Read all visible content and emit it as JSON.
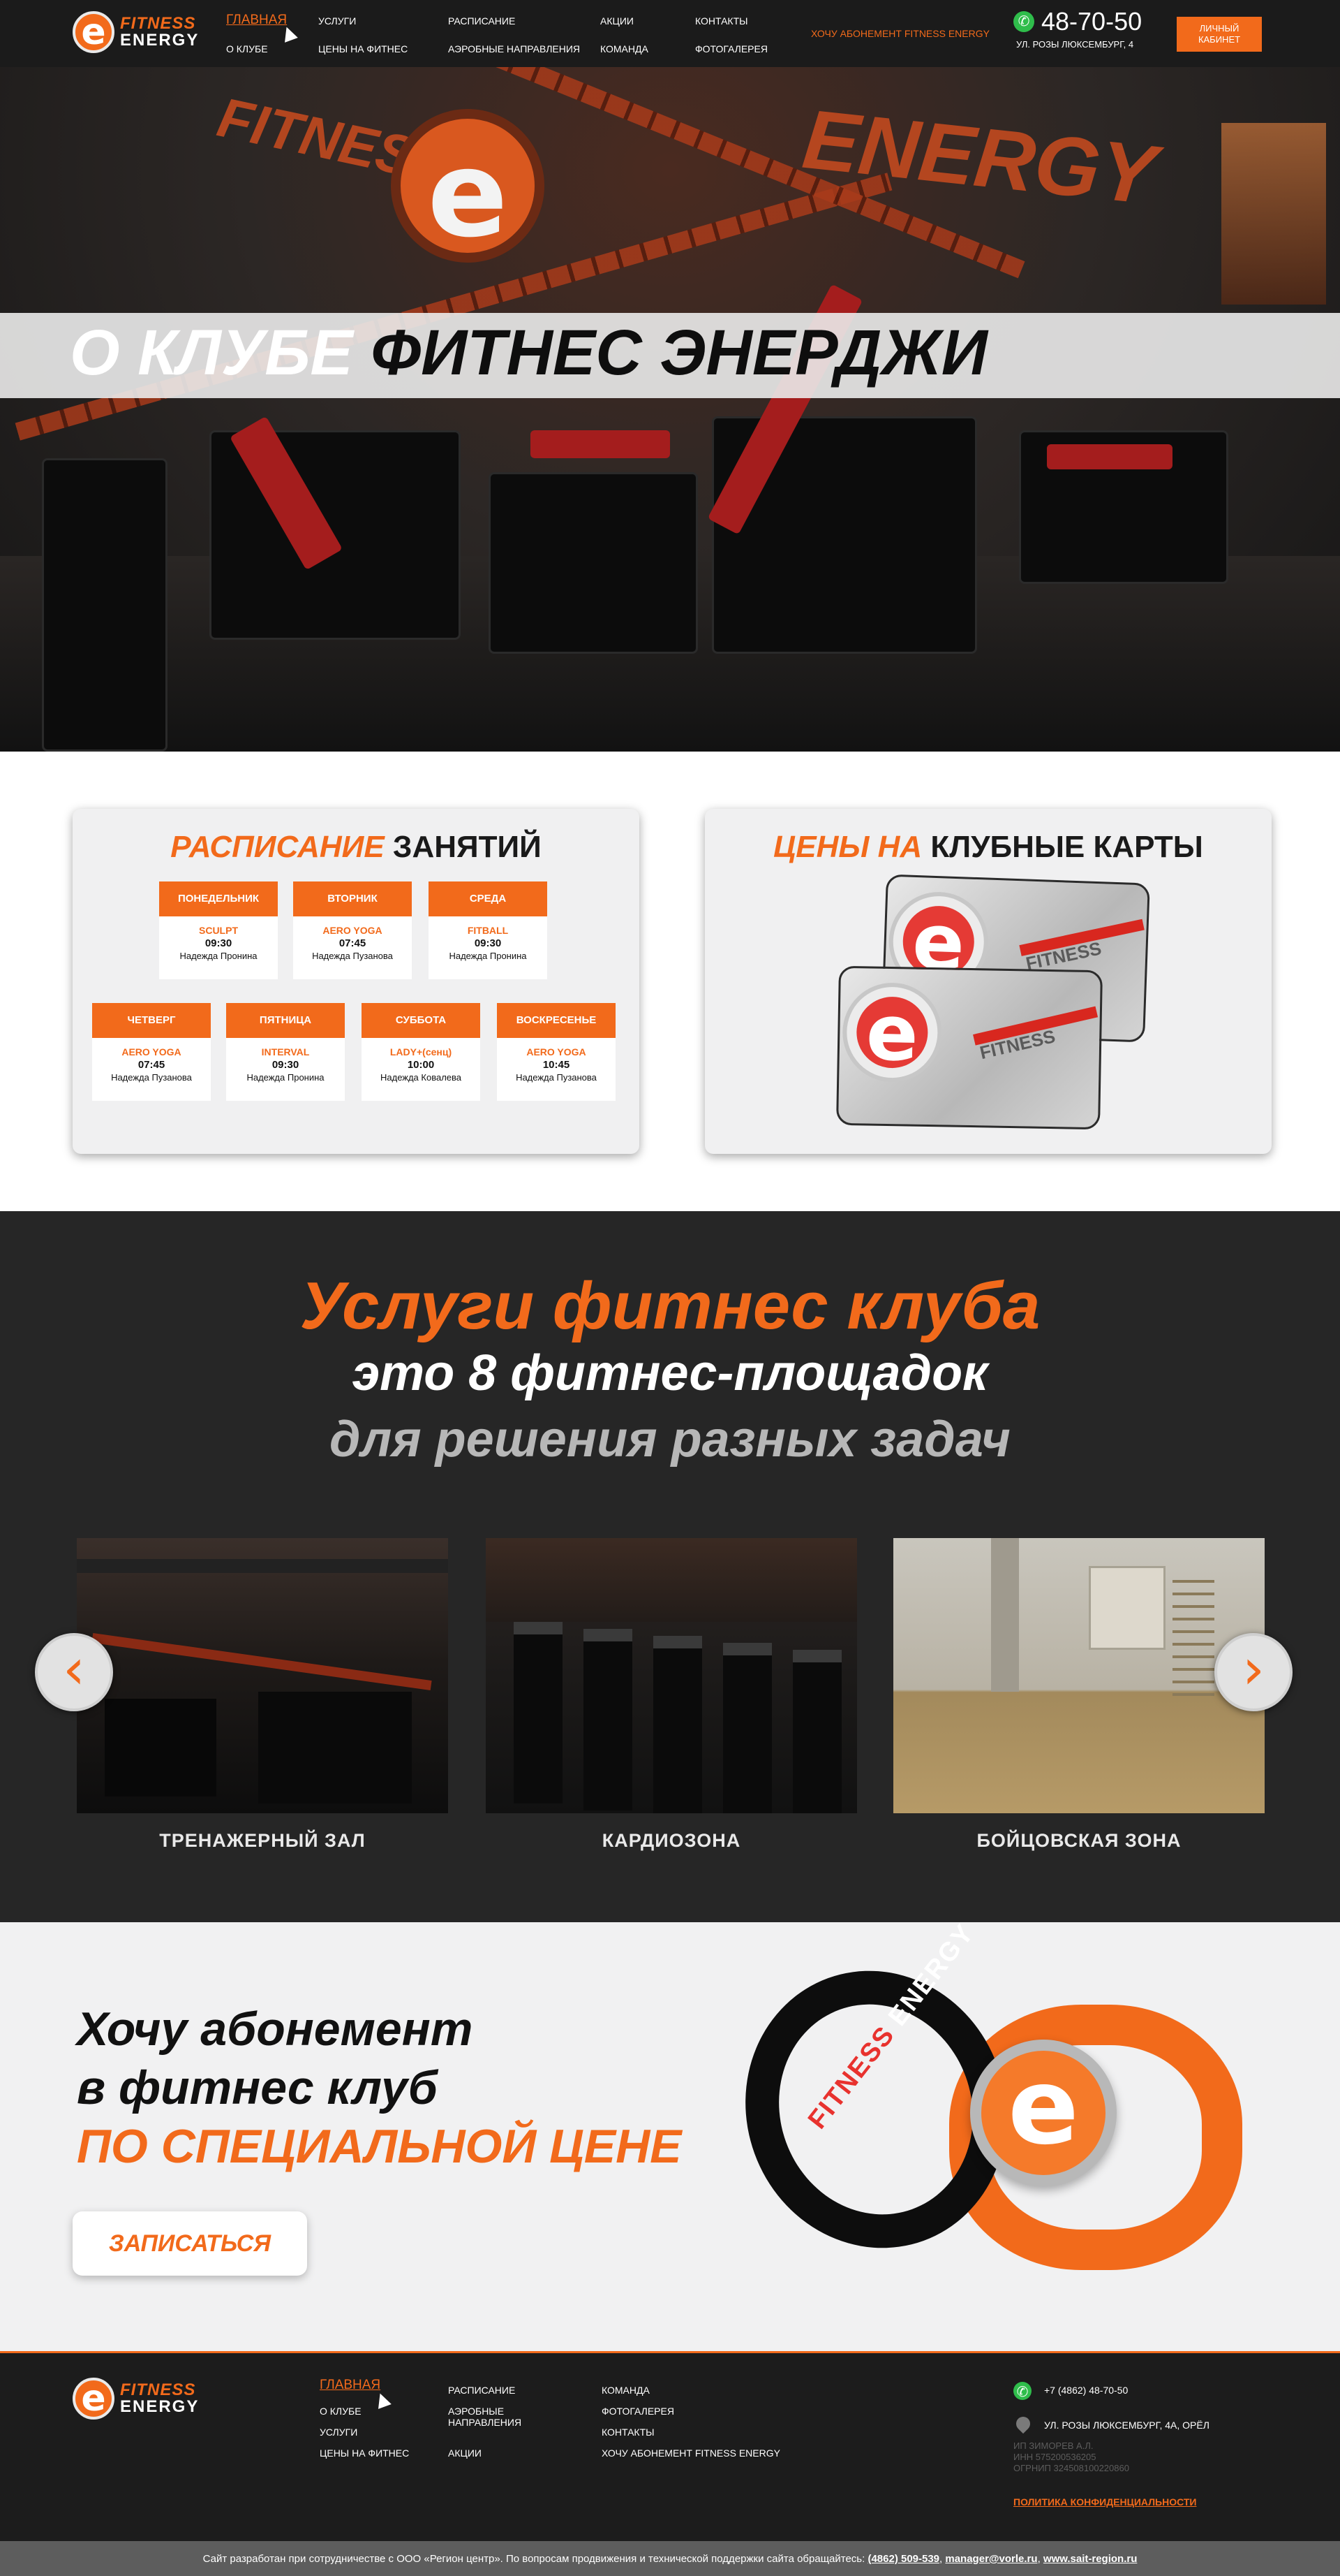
{
  "brand": {
    "word1": "FITNESS",
    "word2": "ENERGY"
  },
  "header": {
    "nav": [
      "ГЛАВНАЯ",
      "О КЛУБЕ",
      "УСЛУГИ",
      "ЦЕНЫ НА ФИТНЕС",
      "РАСПИСАНИЕ",
      "АЭРОБНЫЕ НАПРАВЛЕНИЯ",
      "АКЦИИ",
      "КОМАНДА",
      "КОНТАКТЫ",
      "ФОТОГАЛЕРЕЯ"
    ],
    "promo_link": "ХОЧУ АБОНЕМЕНТ FITNESS ENERGY",
    "phone": "48-70-50",
    "address": "УЛ. РОЗЫ ЛЮКСЕМБУРГ, 4",
    "cabinet_line1": "ЛИЧНЫЙ",
    "cabinet_line2": "КАБИНЕТ"
  },
  "hero": {
    "title_light": "О КЛУБЕ",
    "title_dark": "ФИТНЕС ЭНЕРДЖИ",
    "wall_word_left": "FITNESS",
    "wall_word_right": "ENERGY"
  },
  "schedule": {
    "title_accent": "РАСПИСАНИЕ",
    "title_rest": "ЗАНЯТИЙ",
    "days": [
      {
        "day": "ПОНЕДЕЛЬНИК",
        "class": "SCULPT",
        "time": "09:30",
        "trainer": "Надежда Пронина"
      },
      {
        "day": "ВТОРНИК",
        "class": "AERO YOGA",
        "time": "07:45",
        "trainer": "Надежда Пузанова"
      },
      {
        "day": "СРЕДА",
        "class": "FITBALL",
        "time": "09:30",
        "trainer": "Надежда Пронина"
      },
      {
        "day": "ЧЕТВЕРГ",
        "class": "AERO YOGA",
        "time": "07:45",
        "trainer": "Надежда Пузанова"
      },
      {
        "day": "ПЯТНИЦА",
        "class": "INTERVAL",
        "time": "09:30",
        "trainer": "Надежда Пронина"
      },
      {
        "day": "СУББОТА",
        "class": "LADY+(сенц)",
        "time": "10:00",
        "trainer": "Надежда Ковалева"
      },
      {
        "day": "ВОСКРЕСЕНЬЕ",
        "class": "AERO YOGA",
        "time": "10:45",
        "trainer": "Надежда Пузанова"
      }
    ]
  },
  "prices": {
    "title_accent": "ЦЕНЫ НА",
    "title_rest": "КЛУБНЫЕ КАРТЫ",
    "card_word": "FITNESS"
  },
  "services": {
    "heading1": "Услуги фитнес клуба",
    "heading2": "это 8 фитнес-площадок",
    "heading3": "для решения разных задач",
    "slides": [
      {
        "caption": "ТРЕНАЖЕРНЫЙ ЗАЛ"
      },
      {
        "caption": "КАРДИОЗОНА"
      },
      {
        "caption": "БОЙЦОВСКАЯ ЗОНА"
      }
    ],
    "prev": "‹",
    "next": "›"
  },
  "promo": {
    "line1": "Хочу абонемент",
    "line2": "в фитнес клуб",
    "line3": "ПО СПЕЦИАЛЬНОЙ ЦЕНЕ",
    "button": "ЗАПИСАТЬСЯ",
    "band_word1": "FITNESS",
    "band_word2": "ENERGY"
  },
  "footer": {
    "nav": [
      "ГЛАВНАЯ",
      "О КЛУБЕ",
      "УСЛУГИ",
      "ЦЕНЫ НА ФИТНЕС",
      "РАСПИСАНИЕ",
      "АЭРОБНЫЕ",
      "НАПРАВЛЕНИЯ",
      "АКЦИИ",
      "КОМАНДА",
      "ФОТОГАЛЕРЕЯ",
      "КОНТАКТЫ",
      "ХОЧУ АБОНЕМЕНТ FITNESS ENERGY"
    ],
    "phone": "+7 (4862) 48-70-50",
    "address": "УЛ. РОЗЫ ЛЮКСЕМБУРГ, 4А, ОРЁЛ",
    "legal1": "ИП ЗИМОРЕВ А.Л.",
    "legal2": "ИНН 575200536205",
    "legal3": "ОГРНИП 324508100220860",
    "privacy": "ПОЛИТИКА КОНФИДЕНЦИАЛЬНОСТИ"
  },
  "bottom": {
    "text": "Сайт разработан при сотрудничестве с ООО «Регион центр». По вопросам продвижения и технической поддержки сайта обращайтесь:",
    "phone": "(4862) 509-539",
    "email": "manager@vorle.ru",
    "site": "www.sait-region.ru"
  },
  "colors": {
    "accent": "#f26a1b",
    "dark": "#262626",
    "header": "#1b1b1b",
    "whatsapp": "#2fbd4b"
  }
}
